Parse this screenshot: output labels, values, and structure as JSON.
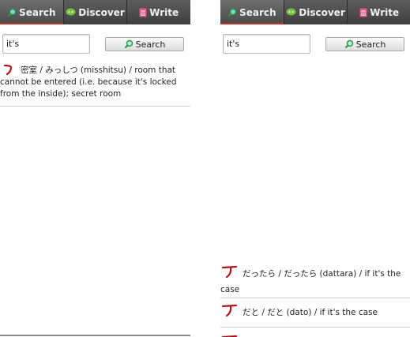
{
  "tabs": [
    {
      "label": "Search",
      "icon": "search-icon"
    },
    {
      "label": "Discover",
      "icon": "chat-bubble-icon"
    },
    {
      "label": "Write",
      "icon": "notepad-icon"
    }
  ],
  "left": {
    "query": "it's",
    "button_label": "Search",
    "results": [
      {
        "text": "密室 / みっしつ (misshitsu) / room that cannot be entered (i.e. because it's locked from the inside); secret room"
      }
    ]
  },
  "right": {
    "query": "it's",
    "button_label": "Search",
    "results": [
      {
        "text": "だったら / だったら (dattara) / if it's the case"
      },
      {
        "text": "だと / だと (dato) / if it's the case"
      }
    ]
  },
  "colors": {
    "tab_active_underline": "#b8362b",
    "stroke_red": "#b3141c"
  }
}
